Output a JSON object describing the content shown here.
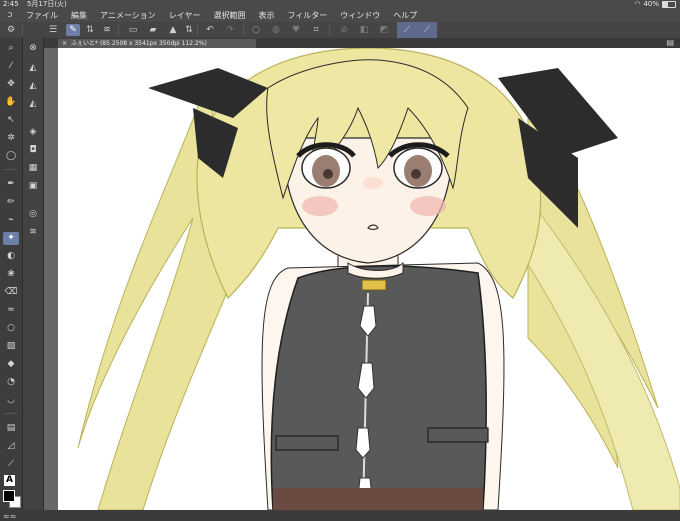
{
  "status": {
    "time": "2:45",
    "date": "5月17日(火)",
    "battery": "40%"
  },
  "menu": [
    "ファイル",
    "編集",
    "アニメーション",
    "レイヤー",
    "選択範囲",
    "表示",
    "フィルター",
    "ウィンドウ",
    "ヘルプ"
  ],
  "document": {
    "tab_title": "ふぇいと* (85 2508 x 3541px 350dpi 112.2%)",
    "close_glyph": "×"
  },
  "icons": {
    "app_logo": "clip-studio-logo-icon",
    "tool_text": "A"
  },
  "colors": {
    "main": "#000000",
    "sub": "#ffffff",
    "accent": "#6d7fa8"
  }
}
